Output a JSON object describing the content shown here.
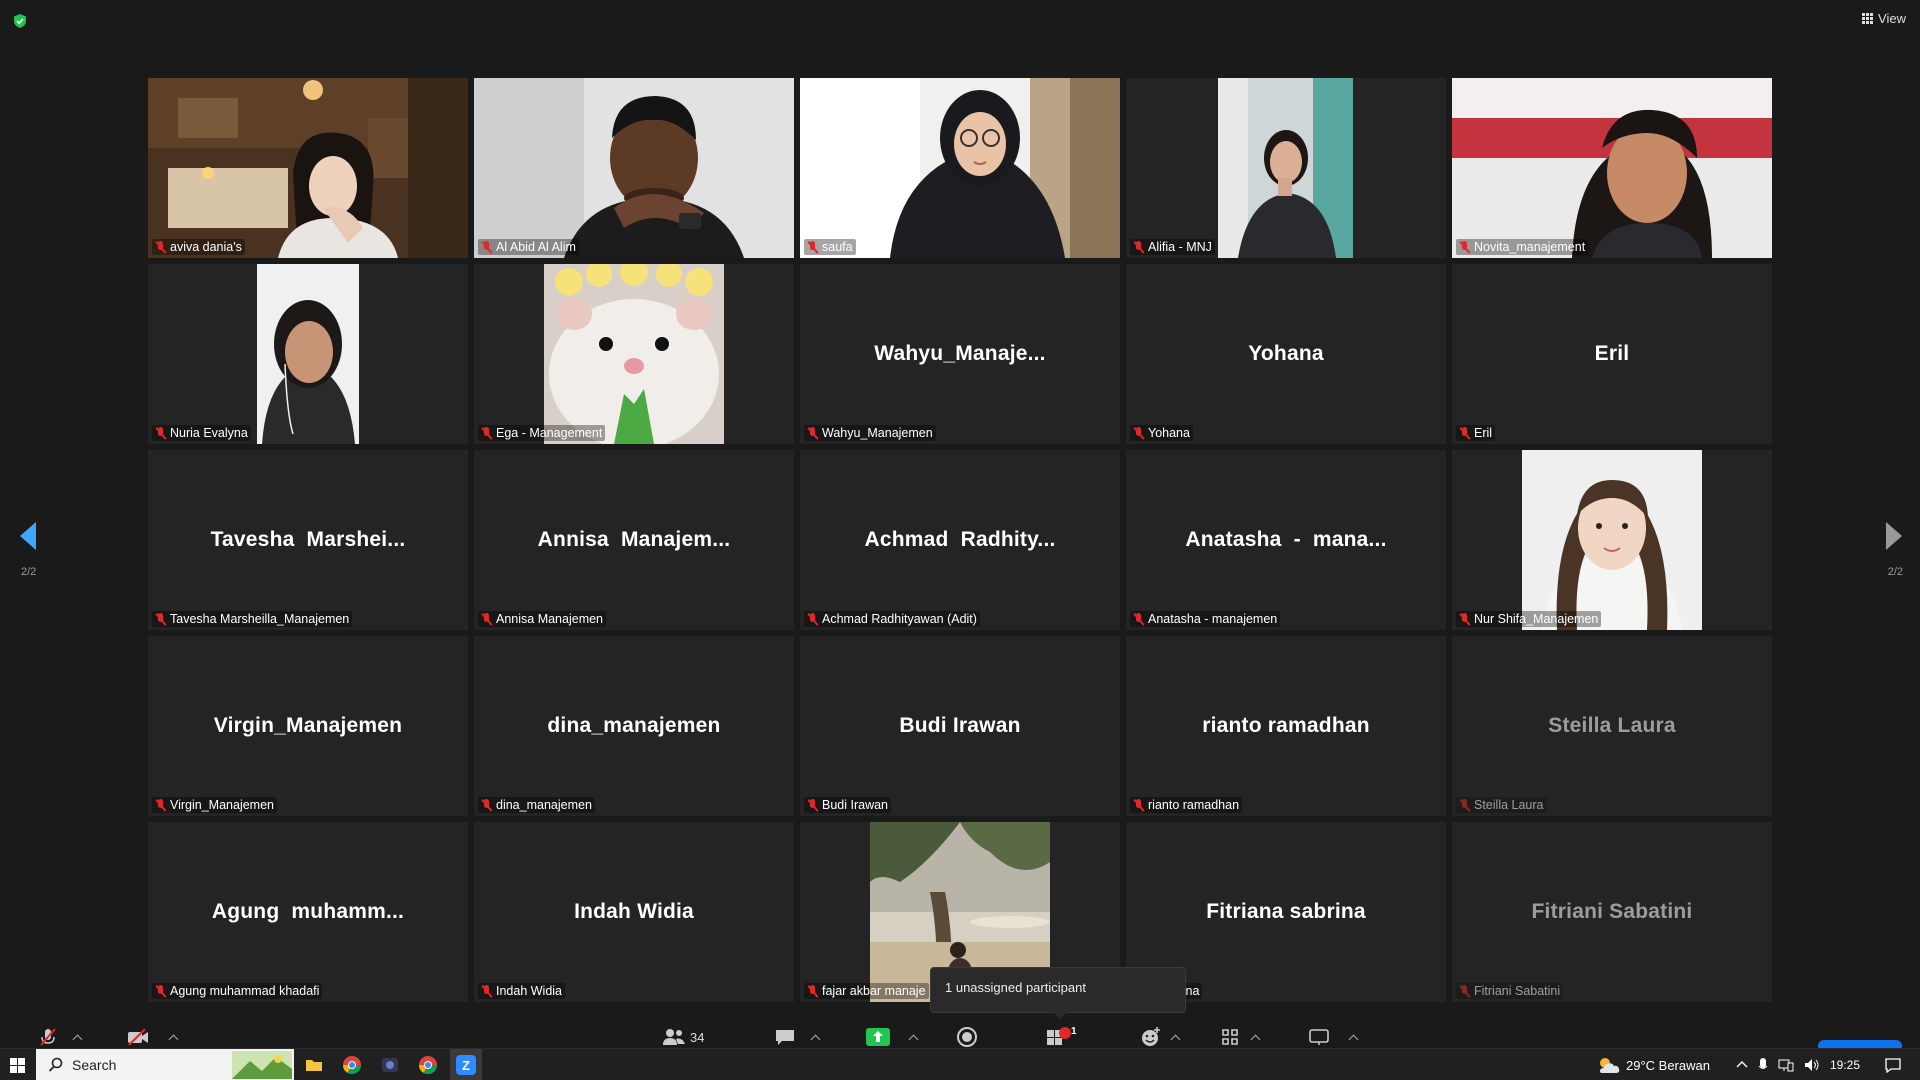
{
  "top_bar": {
    "view_label": "View"
  },
  "participants": [
    {
      "name": "aviva dania's",
      "video": "bedroom"
    },
    {
      "name": "Al Abid Al Alim",
      "video": "man"
    },
    {
      "name": "saufa",
      "video": "hijab"
    },
    {
      "name": "Alifia - MNJ",
      "video": "portrait-narrow"
    },
    {
      "name": "Novita_manajement",
      "video": "girl-red"
    },
    {
      "name": "Nuria Evalyna",
      "video": "portrait-narrow-2"
    },
    {
      "name": "Ega - Management",
      "video": "hamster"
    },
    {
      "name": "Wahyu_Manajemen",
      "display": "Wahyu_Manaje..."
    },
    {
      "name": "Yohana",
      "display": "Yohana"
    },
    {
      "name": "Eril",
      "display": "Eril"
    },
    {
      "name": "Tavesha Marsheilla_Manajemen",
      "display": "Tavesha  Marshei..."
    },
    {
      "name": "Annisa Manajemen",
      "display": "Annisa  Manajem..."
    },
    {
      "name": "Achmad Radhityawan (Adit)",
      "display": "Achmad  Radhity..."
    },
    {
      "name": "Anatasha - manajemen",
      "display": "Anatasha  -  mana..."
    },
    {
      "name": "Nur Shifa_Manajemen",
      "video": "photo-girl"
    },
    {
      "name": "Virgin_Manajemen",
      "display": "Virgin_Manajemen"
    },
    {
      "name": "dina_manajemen",
      "display": "dina_manajemen"
    },
    {
      "name": "Budi Irawan",
      "display": "Budi Irawan"
    },
    {
      "name": "rianto ramadhan",
      "display": "rianto ramadhan"
    },
    {
      "name": "Steilla Laura",
      "display": "Steilla Laura",
      "faded": true
    },
    {
      "name": "Agung muhammad khadafi",
      "display": "Agung  muhamm..."
    },
    {
      "name": "Indah Widia",
      "display": "Indah Widia"
    },
    {
      "name": "fajar akbar manaje",
      "video": "beach"
    },
    {
      "name": "a sabrina",
      "display": "Fitriana sabrina"
    },
    {
      "name": "Fitriani Sabatini",
      "display": "Fitriani Sabatini",
      "faded": true
    }
  ],
  "pagination": {
    "left": "2/2",
    "right": "2/2"
  },
  "tooltip": "1 unassigned participant",
  "toolbar": {
    "participants_count": "34",
    "breakout_badge": "1"
  },
  "taskbar": {
    "search_placeholder": "Search",
    "weather": "29°C  Berawan",
    "time": "19:25"
  },
  "colors": {
    "background": "#1a1a1a",
    "tile": "#242424",
    "mute_red": "#e02828",
    "accent_blue": "#3ea6ff",
    "share_green": "#23c552"
  }
}
